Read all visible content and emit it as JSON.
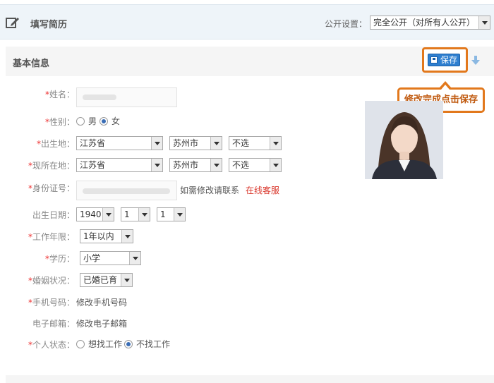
{
  "header": {
    "title": "填写简历",
    "visibility_label": "公开设置：",
    "visibility_value": "完全公开（对所有人公开）"
  },
  "section": {
    "title": "基本信息",
    "save_label": "保存",
    "tooltip": "修改完成点击保存"
  },
  "form": {
    "name": {
      "required": "*",
      "label": "姓名："
    },
    "gender": {
      "required": "*",
      "label": "性别：",
      "options": [
        "男",
        "女"
      ],
      "selected": "女"
    },
    "birthplace": {
      "required": "*",
      "label": "出生地：",
      "province": "江苏省",
      "city": "苏州市",
      "district": "不选"
    },
    "residence": {
      "required": "*",
      "label": "现所在地：",
      "province": "江苏省",
      "city": "苏州市",
      "district": "不选"
    },
    "id_number": {
      "required": "*",
      "label": "身份证号：",
      "hint": "如需修改请联系",
      "link": "在线客服"
    },
    "birthdate": {
      "label": "出生日期：",
      "year": "1940",
      "month": "1",
      "day": "1"
    },
    "work_years": {
      "required": "*",
      "label": "工作年限：",
      "value": "1年以内"
    },
    "education": {
      "required": "*",
      "label": "学历：",
      "value": "小学"
    },
    "marital": {
      "required": "*",
      "label": "婚姻状况：",
      "value": "已婚已育"
    },
    "phone": {
      "required": "*",
      "label": "手机号码：",
      "value": "修改手机号码"
    },
    "email": {
      "label": "电子邮箱：",
      "value": "修改电子邮箱"
    },
    "status": {
      "required": "*",
      "label": "个人状态：",
      "options": [
        "想找工作",
        "不找工作"
      ],
      "selected": "不找工作"
    }
  },
  "colors": {
    "accent": "#e2781c",
    "required": "#ee3333",
    "link": "#d9362b",
    "save_button": "#2e7fd0"
  },
  "icons": {
    "header": "edit-pen-icon",
    "save": "floppy-disk-icon",
    "expand": "arrow-down-icon"
  }
}
